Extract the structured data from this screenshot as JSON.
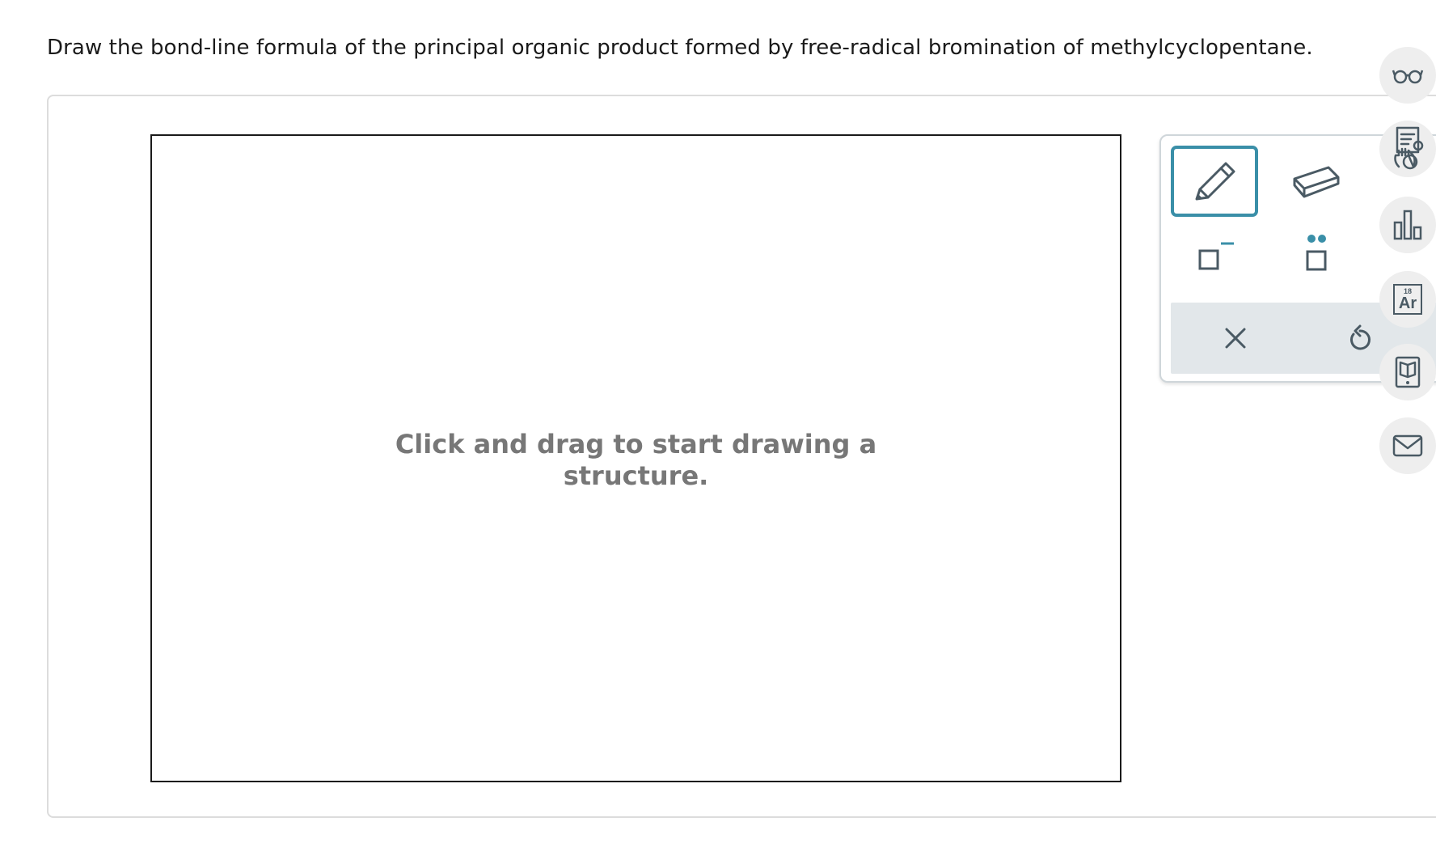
{
  "question": {
    "text": "Draw the bond-line formula of the principal organic product formed by free-radical bromination of methylcyclopentane."
  },
  "canvas": {
    "hint_line1": "Click and drag to start drawing a",
    "hint_line2": "structure."
  },
  "toolbox": {
    "tools": [
      {
        "name": "pencil",
        "icon": "pencil-icon",
        "active": true
      },
      {
        "name": "eraser",
        "icon": "eraser-icon",
        "active": false
      },
      {
        "name": "charge",
        "icon": "charge-icon",
        "active": false
      },
      {
        "name": "lone-pair",
        "icon": "lone-pair-icon",
        "active": false
      }
    ],
    "actions": [
      {
        "name": "clear",
        "icon": "close-icon"
      },
      {
        "name": "undo",
        "icon": "undo-icon"
      }
    ]
  },
  "sidebar": {
    "buttons": [
      {
        "name": "accessibility",
        "icon": "glasses-icon"
      },
      {
        "name": "hint",
        "icon": "hint-icon"
      },
      {
        "name": "stats",
        "icon": "bar-chart-icon"
      },
      {
        "name": "periodic-table",
        "icon": "periodic-table-icon",
        "element_number": "18",
        "element_symbol": "Ar"
      },
      {
        "name": "textbook",
        "icon": "book-icon"
      },
      {
        "name": "message",
        "icon": "mail-icon"
      }
    ]
  },
  "colors": {
    "accent": "#3a8fa8",
    "icon_gray": "#4a5a64",
    "hint_text": "#777777",
    "action_bar": "#e2e7ea"
  }
}
